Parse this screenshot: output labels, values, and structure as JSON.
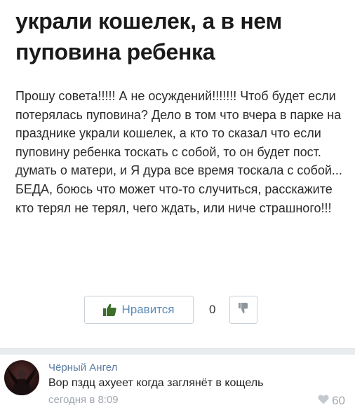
{
  "post": {
    "title": "украли кошелек, а в нем пуповина ребенка",
    "body": "Прошу совета!!!!! А не осуждений!!!!!!! Чтоб будет если потерялась пуповина? Дело в том что вчера в парке на празднике украли кошелек, а кто то сказал что если пуповину ребенка тоскать с собой, то он будет пост. думать о матери, и Я дура все время тоскала с собой... БЕДА, боюсь что может что-то случиться, расскажите кто терял не терял, чего ждать, или ниче страшного!!!"
  },
  "actions": {
    "like_label": "Нравится",
    "like_icon": "thumbs-up-icon",
    "count": "0",
    "dislike_icon": "thumbs-down-icon"
  },
  "comment": {
    "author": "Чёрный Ангел",
    "text": "Вор пздц ахуеет когда заглянёт в кощель",
    "timestamp": "сегодня в 8:09",
    "likes": "60",
    "heart_icon": "heart-icon"
  },
  "colors": {
    "accent": "#5b8bb8",
    "author": "#5d7fa4",
    "muted": "#a2a8b0"
  }
}
